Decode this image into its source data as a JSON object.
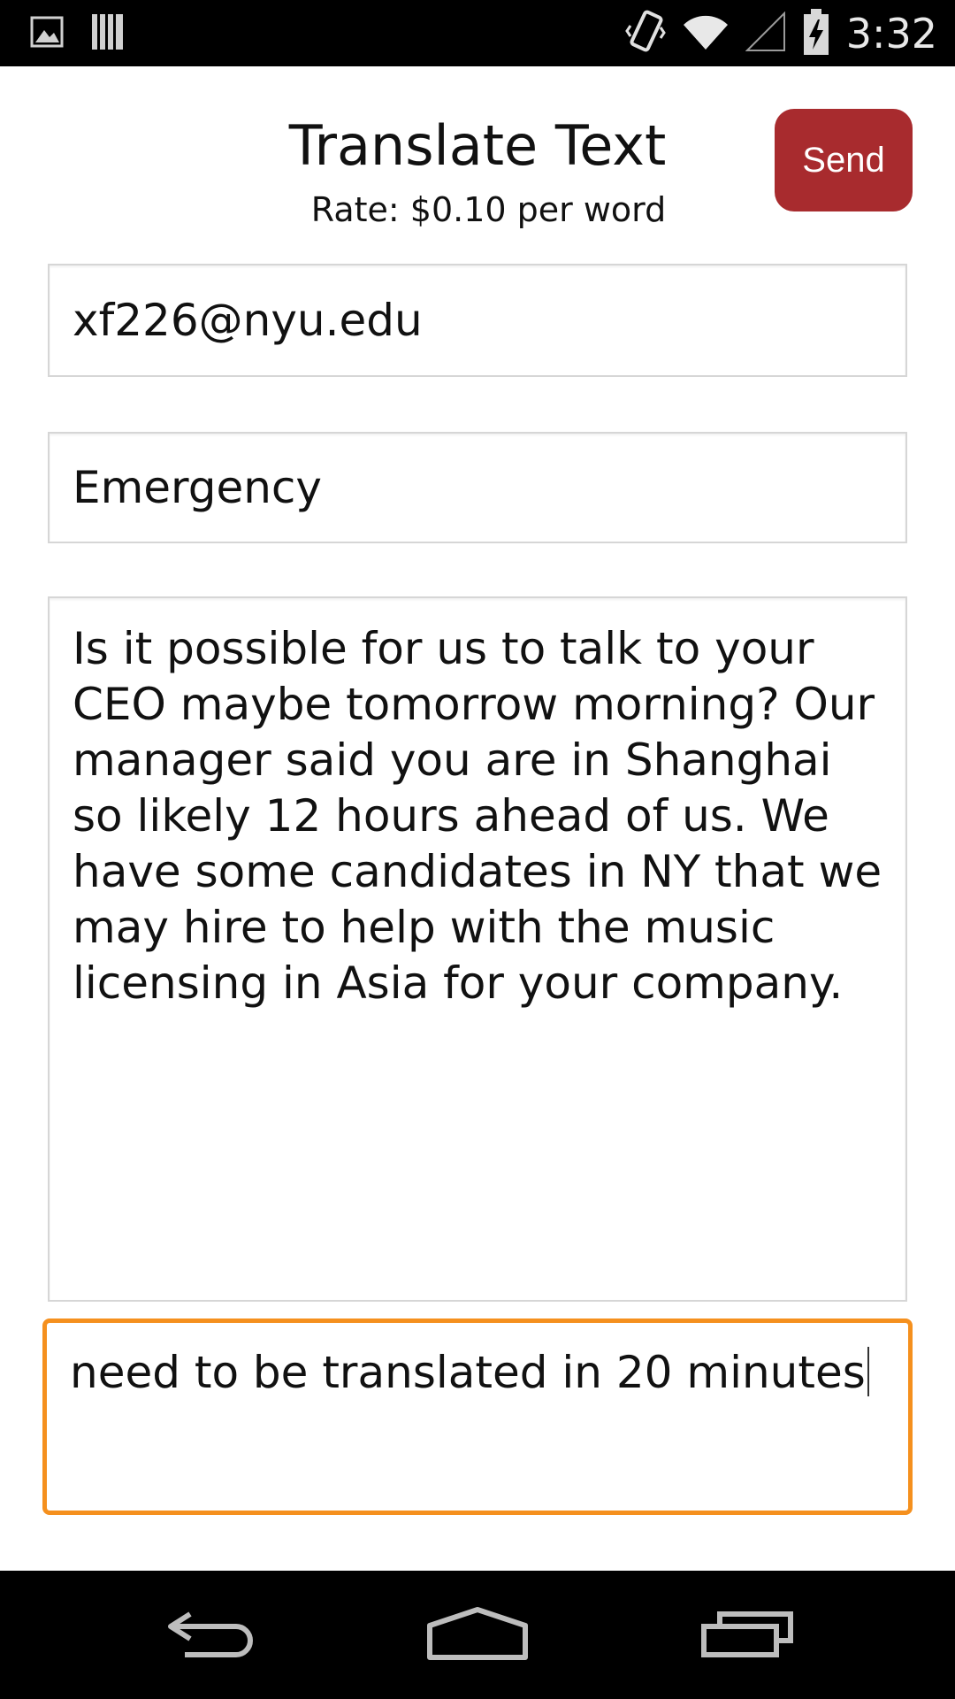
{
  "status_bar": {
    "time": "3:32",
    "icons": [
      "image-icon",
      "bars-icon",
      "vibrate-icon",
      "wifi-icon",
      "signal-icon",
      "battery-icon"
    ]
  },
  "header": {
    "title": "Translate Text",
    "rate": "Rate: $0.10 per word",
    "send_label": "Send"
  },
  "form": {
    "email_value": "xf226@nyu.edu",
    "subject_value": "Emergency",
    "body_value": "Is it possible for us to talk to your CEO maybe tomorrow morning? Our manager said you are in Shanghai so likely 12 hours ahead of us.  We have some candidates in NY that we may hire to help with the music licensing in Asia for your company.",
    "note_value": "need to be translated in 20 minutes"
  },
  "nav_bar": {
    "icons": [
      "back-icon",
      "home-icon",
      "recent-apps-icon"
    ]
  },
  "colors": {
    "send_button": "#a82b2e",
    "focus_border": "#f5901e",
    "status_bar": "#000000"
  }
}
